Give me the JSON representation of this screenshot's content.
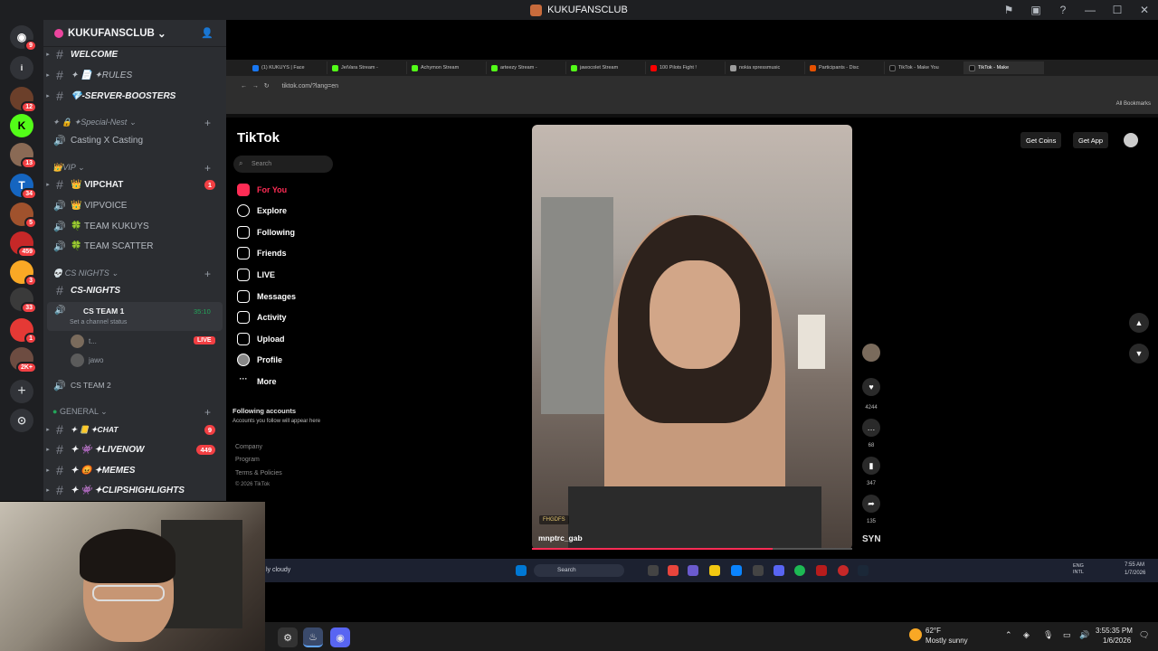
{
  "window": {
    "title": "KUKUFANSCLUB"
  },
  "rail": {
    "badges": [
      "9",
      "12",
      "13",
      "34",
      "5",
      "459",
      "3",
      "33",
      "1",
      "2K+"
    ]
  },
  "guild": {
    "name": "KUKUFANSCLUB"
  },
  "channels": {
    "welcome": "WELCOME",
    "rules": "✦ 📄 ✦RULES",
    "boosters": "💎-SERVER-BOOSTERS",
    "cat_special": "✦ 🔒 ✦Special-Nest",
    "casting": "Casting X Casting",
    "cat_vip": "👑VIP",
    "vipchat": "👑 VIPCHAT",
    "vipchat_badge": "1",
    "vipvoice": "👑 VIPVOICE",
    "kukuys": "🍀 TEAM KUKUYS",
    "scatter": "🍀 TEAM SCATTER",
    "cat_csnights": "💀 CS NIGHTS",
    "csnights": "CS-NIGHTS",
    "csteam1": "CS TEAM 1",
    "csteam1_time": "35:10",
    "csteam1_status": "Set a channel status",
    "user1": "t...",
    "live": "LIVE",
    "user2": "jawo",
    "csteam2": "CS TEAM 2",
    "cat_general": "GENERAL",
    "chat": "✦ 📒 ✦CHAT",
    "chat_badge": "9",
    "livenow": "✦ 👾 ✦LIVENOW",
    "livenow_badge": "449",
    "memes": "✦ 😡 ✦MEMES",
    "clips": "✦ 👾 ✦CLIPSHIGHLIGHTS"
  },
  "browser": {
    "tabs": [
      "(1) KUKUYS | Face",
      "JeiVara Stream -",
      "Achymon Stream",
      "arteezy Stream -",
      "jawocolet Stream",
      "100 Pilots Fight !",
      "nokia xpressmusic",
      "Participants - Disc",
      "TikTok - Make You",
      "TikTok - Make"
    ],
    "url": "tiktok.com/?lang=en",
    "bookmarks": "All Bookmarks"
  },
  "tiktok": {
    "logo": "TikTok",
    "search_placeholder": "Search",
    "nav": [
      "For You",
      "Explore",
      "Following",
      "Friends",
      "LIVE",
      "Messages",
      "Activity",
      "Upload",
      "Profile",
      "More"
    ],
    "following_title": "Following accounts",
    "following_sub": "Accounts you follow will appear here",
    "footer": [
      "Company",
      "Program",
      "Terms & Policies",
      "© 2026 TikTok"
    ],
    "get_coins": "Get Coins",
    "get_app": "Get App",
    "video": {
      "tag": "FHGDFS",
      "user": "mnptrc_gab",
      "progress": 0.75,
      "likes": "4244",
      "comments": "68",
      "saves": "347",
      "shares": "135",
      "sound": "SYN"
    }
  },
  "inner_taskbar": {
    "weather": "ly cloudy",
    "search": "Search",
    "lang": "ENG\nINTL",
    "time": "7:55 AM",
    "date": "1/7/2026"
  },
  "taskbar": {
    "temp": "62°F",
    "weather": "Mostly sunny",
    "time": "3:55:35 PM",
    "date": "1/6/2026"
  }
}
